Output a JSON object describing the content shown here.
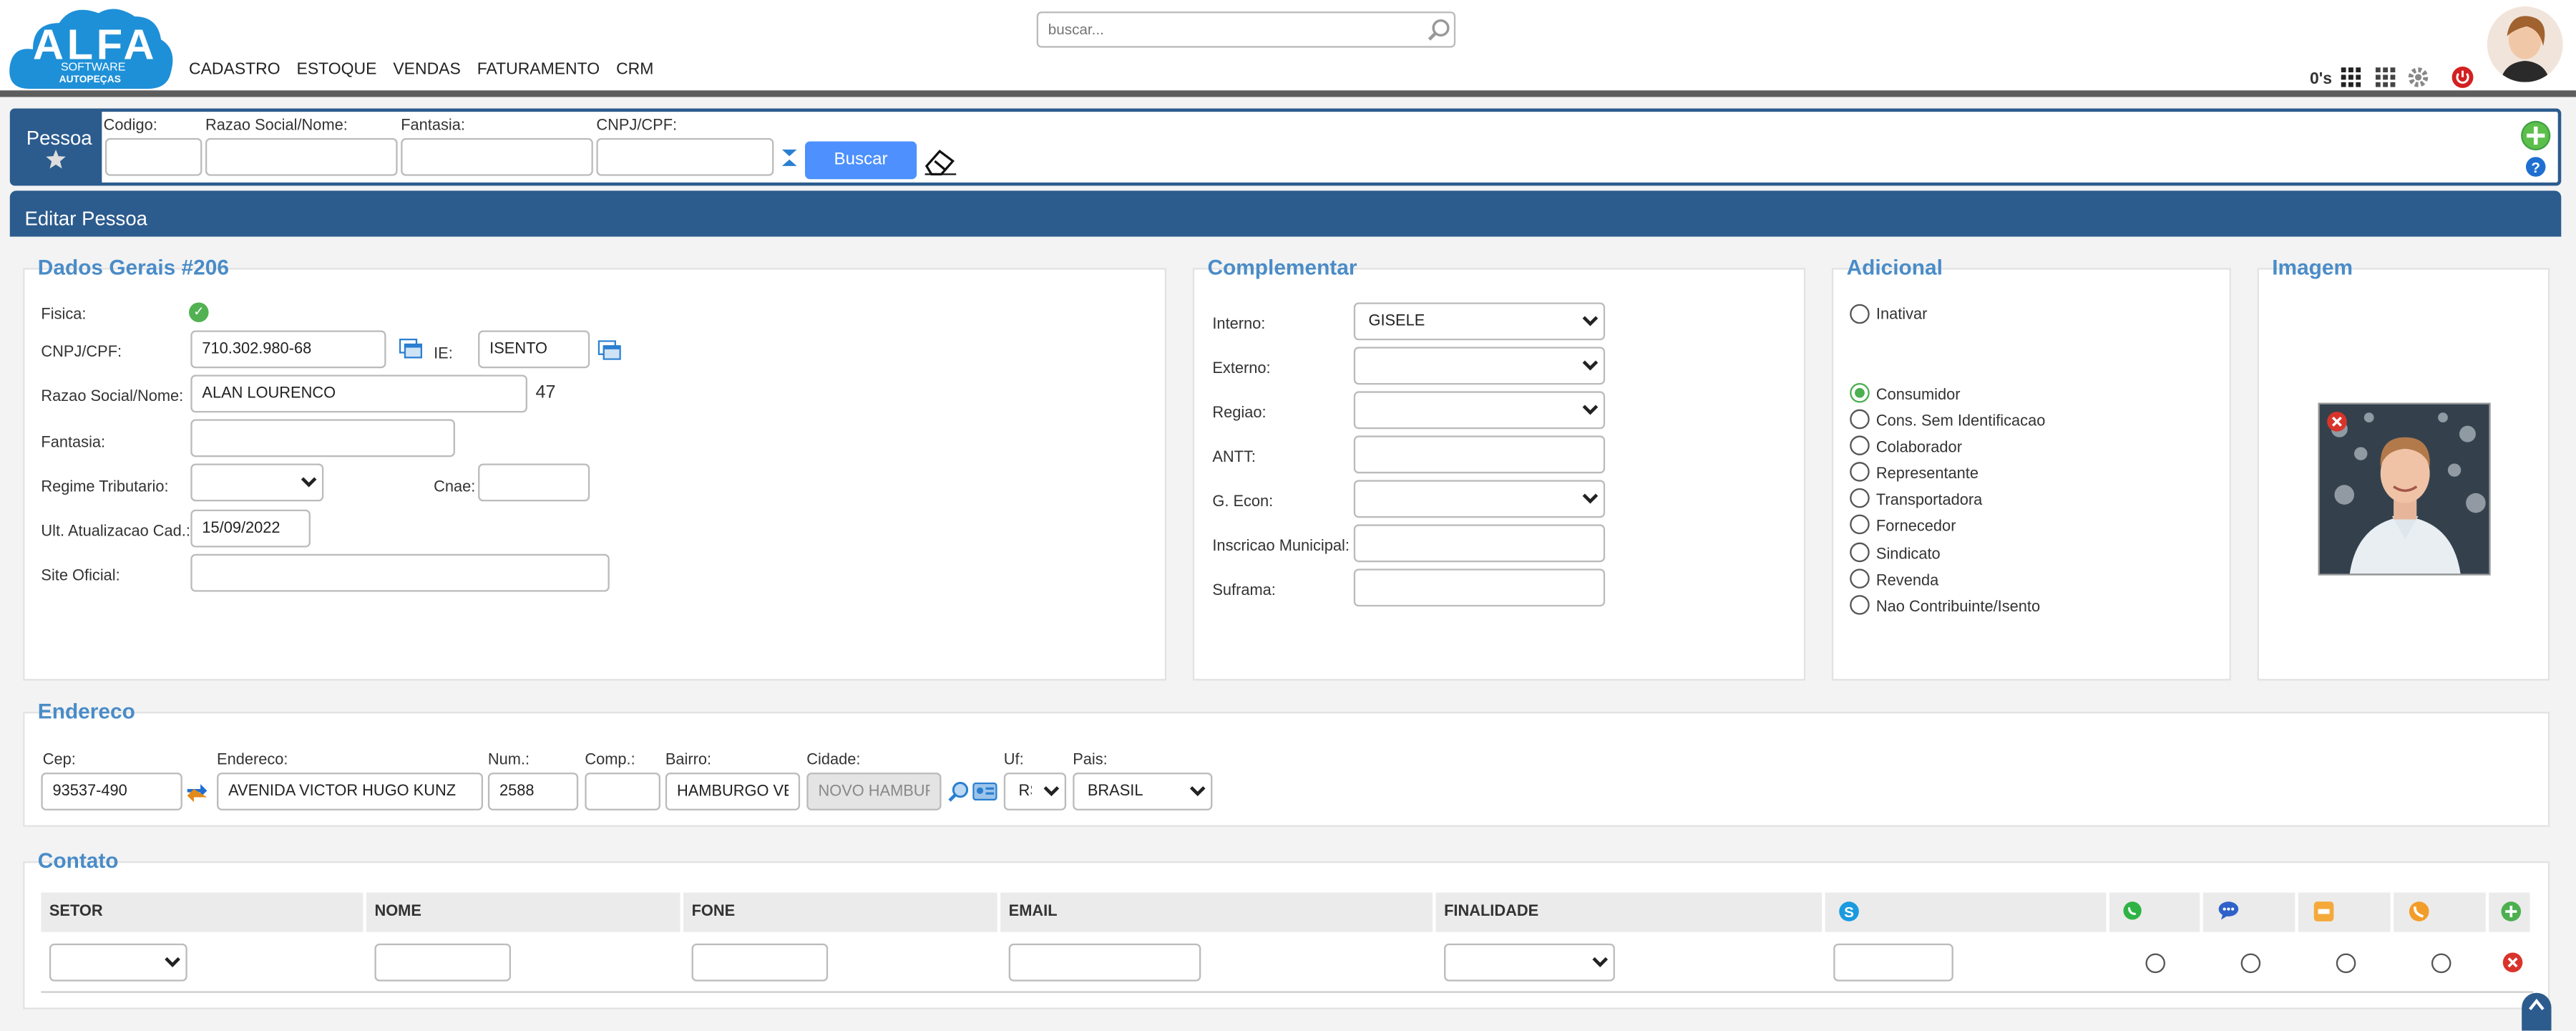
{
  "brand": {
    "logo_main": "ALFA",
    "logo_sub": "SOFTWARE",
    "logo_sub2": "AUTOPEÇAS",
    "primary": "#2c5b8d",
    "accent": "#4d90fe"
  },
  "nav": [
    "CADASTRO",
    "ESTOQUE",
    "VENDAS",
    "FATURAMENTO",
    "CRM"
  ],
  "search": {
    "placeholder": "buscar..."
  },
  "header": {
    "counter": "0's"
  },
  "toolbar": {
    "title": "Pessoa",
    "fields": [
      "Codigo:",
      "Razao Social/Nome:",
      "Fantasia:",
      "CNPJ/CPF:"
    ],
    "search_button": "Buscar"
  },
  "page": {
    "title": "Editar Pessoa"
  },
  "dados": {
    "title": "Dados Gerais #206",
    "fisica_label": "Fisica:",
    "cnpj_label": "CNPJ/CPF:",
    "cnpj_value": "710.302.980-68",
    "ie_label": "IE:",
    "ie_value": "ISENTO",
    "razao_label": "Razao Social/Nome:",
    "razao_value": "ALAN LOURENCO",
    "razao_count": "47",
    "fantasia_label": "Fantasia:",
    "regime_label": "Regime Tributario:",
    "cnae_label": "Cnae:",
    "atual_label": "Ult. Atualizacao Cad.:",
    "atual_value": "15/09/2022",
    "site_label": "Site Oficial:"
  },
  "complementar": {
    "title": "Complementar",
    "interno_label": "Interno:",
    "interno_value": "GISELE",
    "externo_label": "Externo:",
    "regiao_label": "Regiao:",
    "antt_label": "ANTT:",
    "gecon_label": "G. Econ:",
    "inscricao_label": "Inscricao Municipal:",
    "suframa_label": "Suframa:"
  },
  "adicional": {
    "title": "Adicional",
    "inativar": "Inativar",
    "options": [
      {
        "label": "Consumidor",
        "checked": true
      },
      {
        "label": "Cons. Sem Identificacao",
        "checked": false
      },
      {
        "label": "Colaborador",
        "checked": false
      },
      {
        "label": "Representante",
        "checked": false
      },
      {
        "label": "Transportadora",
        "checked": false
      },
      {
        "label": "Fornecedor",
        "checked": false
      },
      {
        "label": "Sindicato",
        "checked": false
      },
      {
        "label": "Revenda",
        "checked": false
      },
      {
        "label": "Nao Contribuinte/Isento",
        "checked": false
      }
    ]
  },
  "imagem": {
    "title": "Imagem"
  },
  "endereco": {
    "title": "Endereco",
    "cep_label": "Cep:",
    "cep_value": "93537-490",
    "end_label": "Endereco:",
    "end_value": "AVENIDA VICTOR HUGO KUNZ",
    "num_label": "Num.:",
    "num_value": "2588",
    "comp_label": "Comp.:",
    "bairro_label": "Bairro:",
    "bairro_value": "HAMBURGO VEI",
    "cidade_label": "Cidade:",
    "cidade_value": "NOVO HAMBUR",
    "uf_label": "Uf:",
    "uf_value": "RS",
    "pais_label": "Pais:",
    "pais_value": "BRASIL"
  },
  "contato": {
    "title": "Contato",
    "columns": [
      "SETOR",
      "NOME",
      "FONE",
      "EMAIL",
      "FINALIDADE"
    ]
  }
}
